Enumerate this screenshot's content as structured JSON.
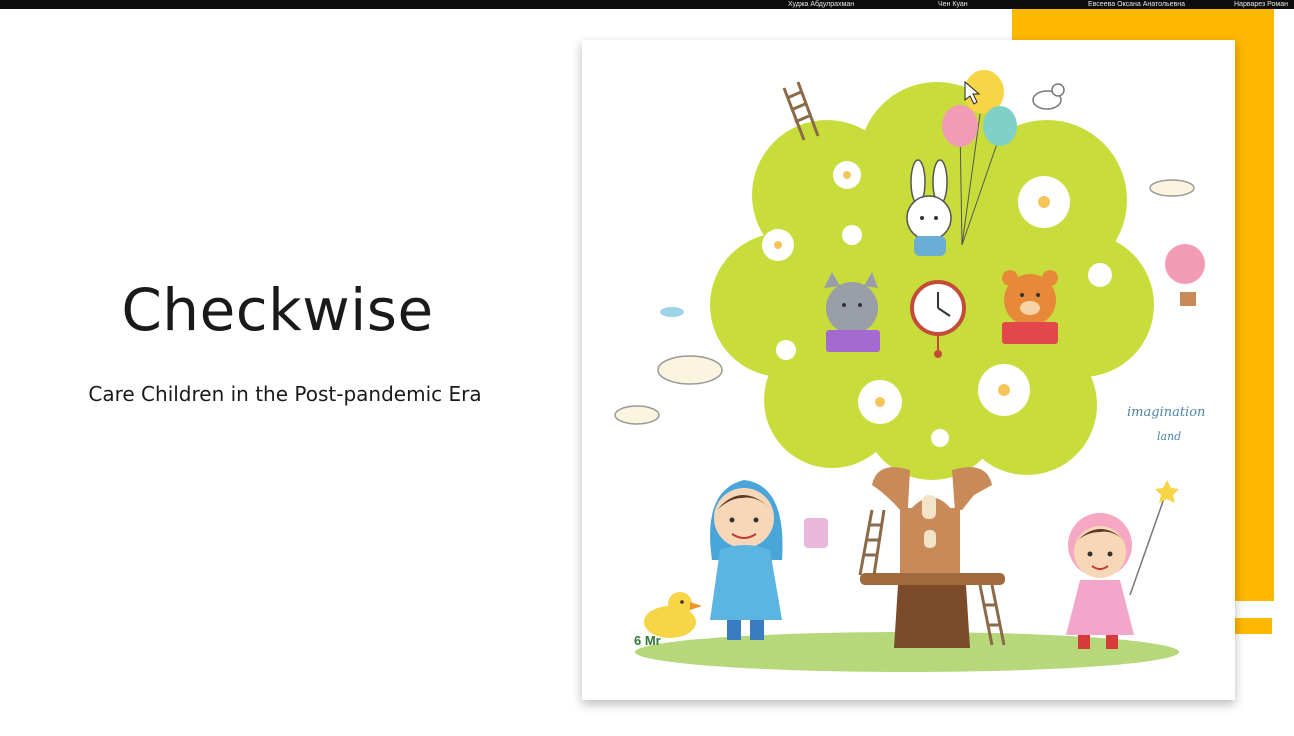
{
  "meeting": {
    "participants": [
      "Худжа Абдулрахман",
      "Чен Куан",
      "Евсеева Оксана Анатольевна",
      "Нарварез Роман"
    ]
  },
  "slide": {
    "title": "Checkwise",
    "subtitle": "Care Children in the Post-pandemic Era",
    "illustration": {
      "handwriting": [
        "imagination",
        "land"
      ],
      "watermark": "6 Mr"
    }
  },
  "colors": {
    "accent_orange": "#ffb800",
    "tree_green": "#c8dc3c",
    "topbar": "#0d0d0d"
  }
}
